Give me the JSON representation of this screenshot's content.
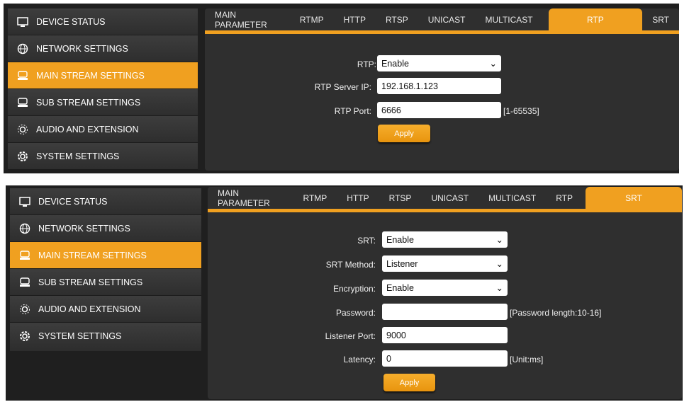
{
  "sidebar": {
    "items": [
      {
        "label": "DEVICE STATUS",
        "icon": "monitor-icon"
      },
      {
        "label": "NETWORK SETTINGS",
        "icon": "globe-icon"
      },
      {
        "label": "MAIN STREAM SETTINGS",
        "icon": "stream-icon",
        "active": true
      },
      {
        "label": "SUB STREAM SETTINGS",
        "icon": "stream-icon"
      },
      {
        "label": "AUDIO AND EXTENSION",
        "icon": "audio-extension-icon"
      },
      {
        "label": "SYSTEM SETTINGS",
        "icon": "gear-icon"
      }
    ]
  },
  "tabs": [
    "MAIN PARAMETER",
    "RTMP",
    "HTTP",
    "RTSP",
    "UNICAST",
    "MULTICAST",
    "RTP",
    "SRT"
  ],
  "rtp": {
    "rtp_label": "RTP:",
    "rtp_value": "Enable",
    "server_label": "RTP Server IP:",
    "server_value": "192.168.1.123",
    "port_label": "RTP Port:",
    "port_value": "6666",
    "port_hint": "[1-65535]",
    "apply": "Apply"
  },
  "srt": {
    "srt_label": "SRT:",
    "srt_value": "Enable",
    "method_label": "SRT Method:",
    "method_value": "Listener",
    "enc_label": "Encryption:",
    "enc_value": "Enable",
    "pw_label": "Password:",
    "pw_value": "",
    "pw_hint": "[Password length:10-16]",
    "port_label": "Listener Port:",
    "port_value": "9000",
    "lat_label": "Latency:",
    "lat_value": "0",
    "lat_hint": "[Unit:ms]",
    "apply": "Apply"
  },
  "colors": {
    "accent": "#f0a020"
  }
}
